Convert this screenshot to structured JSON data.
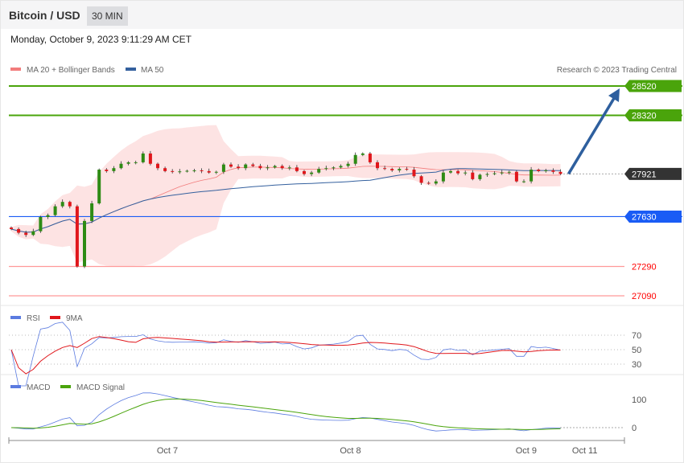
{
  "header": {
    "title": "Bitcoin / USD",
    "timeframe": "30 MIN"
  },
  "date": "Monday, October 9, 2023 9:11:29 AM CET",
  "copyright": "Research © 2023 Trading Central",
  "colors": {
    "up": "#2e8b14",
    "down": "#e0161b",
    "ma20": "#f27c7c",
    "ma50": "#34609e",
    "band": "#fde3e3",
    "resistance": "#4aa40b",
    "support": "#1a5cf5",
    "current": "#333333",
    "lower": "#ff0000",
    "arrow": "#2e5f9e",
    "rsi": "#5b7be0",
    "macd": "#5b7be0",
    "signal": "#4aa40b"
  },
  "legend": {
    "main": [
      {
        "label": "MA 20 + Bollinger Bands",
        "color": "#f27c7c"
      },
      {
        "label": "MA 50",
        "color": "#34609e"
      }
    ],
    "rsi": [
      {
        "label": "RSI",
        "color": "#5b7be0"
      },
      {
        "label": "9MA",
        "color": "#e0161b"
      }
    ],
    "macd": [
      {
        "label": "MACD",
        "color": "#5b7be0"
      },
      {
        "label": "MACD Signal",
        "color": "#4aa40b"
      }
    ]
  },
  "chart_data": {
    "type": "candlestick",
    "ylim": [
      27090,
      28520
    ],
    "levels": [
      {
        "value": 28520,
        "label": "28520",
        "kind": "resistance"
      },
      {
        "value": 28320,
        "label": "28320",
        "kind": "resistance"
      },
      {
        "value": 27921,
        "label": "27921",
        "kind": "current"
      },
      {
        "value": 27630,
        "label": "27630",
        "kind": "support"
      },
      {
        "value": 27290,
        "label": "27290",
        "kind": "lower"
      },
      {
        "value": 27090,
        "label": "27090",
        "kind": "lower"
      }
    ],
    "closes": [
      27545,
      27520,
      27505,
      27530,
      27627,
      27640,
      27700,
      27730,
      27700,
      27290,
      27600,
      27720,
      27950,
      27940,
      27960,
      27990,
      28000,
      28000,
      28060,
      27990,
      27960,
      27940,
      27935,
      27938,
      27942,
      27945,
      27940,
      27930,
      27935,
      27985,
      27970,
      27960,
      27985,
      27975,
      27960,
      27965,
      27975,
      27960,
      27965,
      27940,
      27920,
      27930,
      27955,
      27960,
      27965,
      27975,
      27990,
      28050,
      28060,
      28000,
      27960,
      27955,
      27945,
      27955,
      27950,
      27905,
      27860,
      27855,
      27870,
      27930,
      27940,
      27925,
      27930,
      27885,
      27915,
      27920,
      27925,
      27930,
      27935,
      27870,
      27870,
      27950,
      27940,
      27945,
      27935,
      27921
    ],
    "rsi_ticks": [
      "70",
      "50",
      "30"
    ],
    "macd_ticks": [
      "100",
      "0"
    ],
    "x_ticks": [
      {
        "label": "Oct 7",
        "index": 20
      },
      {
        "label": "Oct 8",
        "index": 45
      },
      {
        "label": "Oct 9",
        "index": 69
      },
      {
        "label": "Oct 11",
        "index": 77
      }
    ],
    "target": 28520
  }
}
